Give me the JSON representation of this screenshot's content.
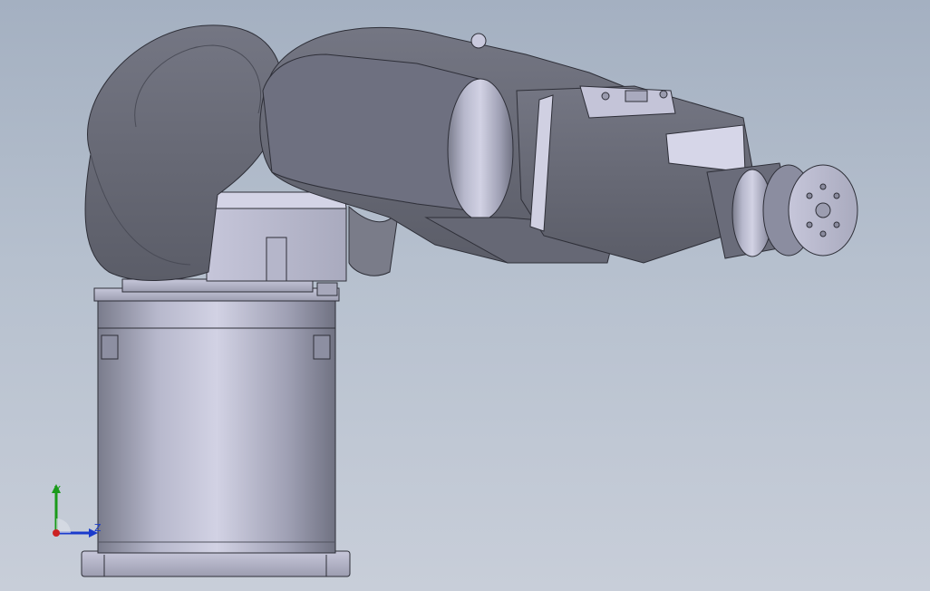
{
  "viewport": {
    "background_top": "#a4b0c1",
    "background_bottom": "#c8ced9",
    "model_color": "#6b6e7a",
    "model_highlight": "#c9c9dd"
  },
  "triad": {
    "y_label": "Y",
    "z_label": "Z",
    "y_color": "#1a9a1a",
    "z_color": "#1a3bcc",
    "origin_color": "#cc2222"
  }
}
